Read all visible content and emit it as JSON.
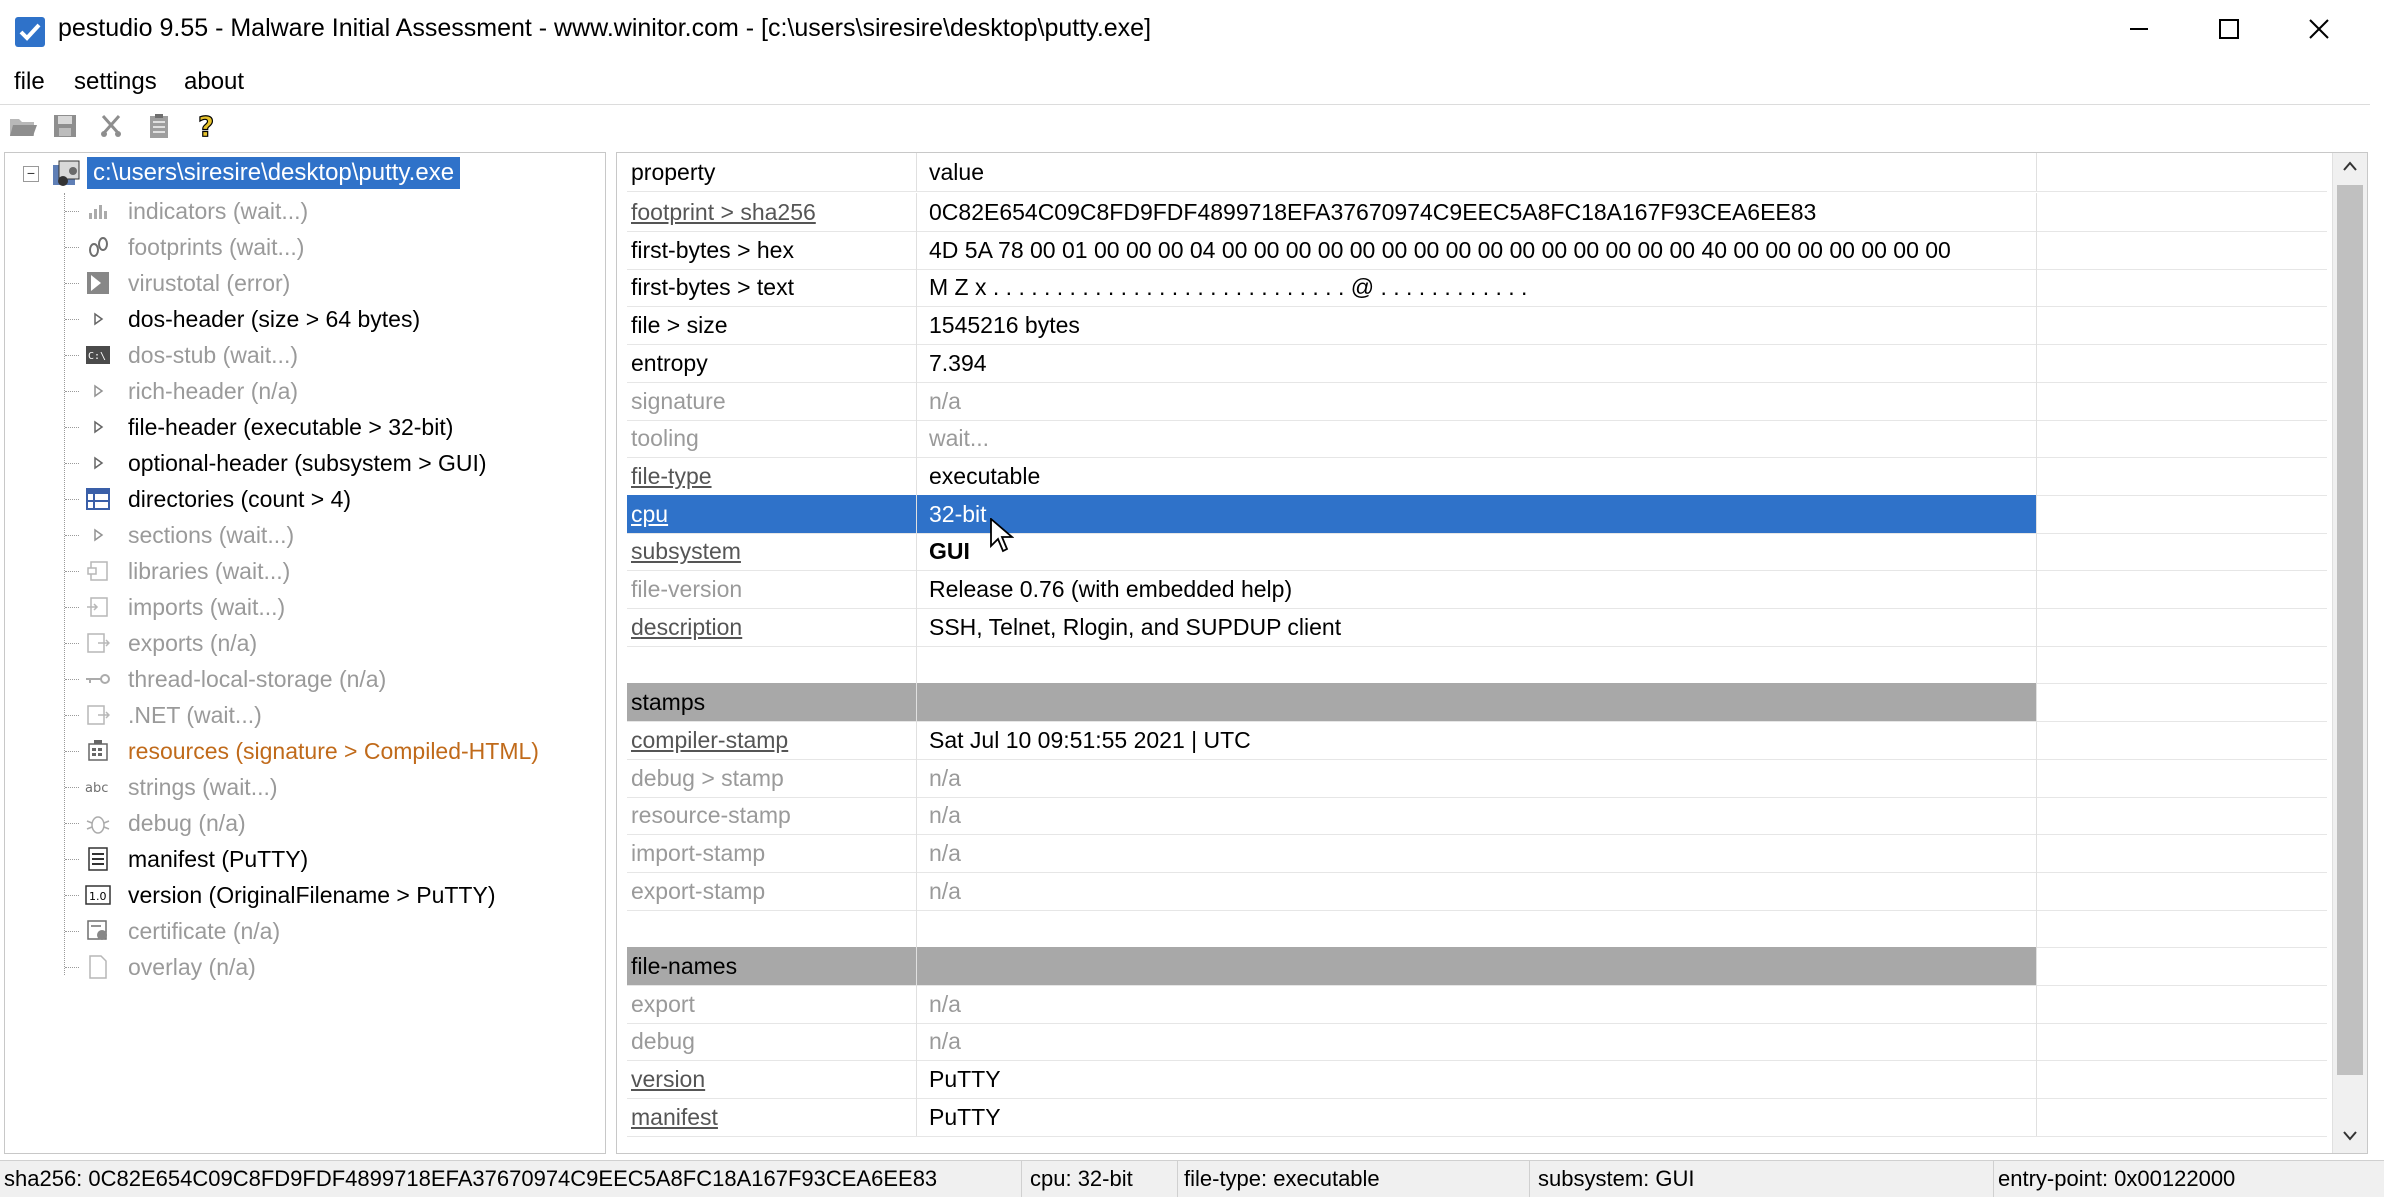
{
  "window": {
    "title": "pestudio 9.55 - Malware Initial Assessment - www.winitor.com - [c:\\users\\siresire\\desktop\\putty.exe]",
    "controls": {
      "minimize": "minimize-icon",
      "maximize": "maximize-icon",
      "close": "close-icon"
    }
  },
  "menubar": {
    "items": [
      "file",
      "settings",
      "about"
    ]
  },
  "toolbar": {
    "buttons": [
      "open-folder-icon",
      "save-icon",
      "cut-icon",
      "clipboard-icon",
      "help-icon"
    ]
  },
  "tree": {
    "root": {
      "label": "c:\\users\\siresire\\desktop\\putty.exe",
      "icon": "executable-icon",
      "expander": "−"
    },
    "items": [
      {
        "label": "indicators (wait...)",
        "icon": "bar-chart-icon",
        "state": "disabled"
      },
      {
        "label": "footprints (wait...)",
        "icon": "footprint-icon",
        "state": "disabled"
      },
      {
        "label": "virustotal (error)",
        "icon": "virustotal-icon",
        "state": "disabled"
      },
      {
        "label": "dos-header (size > 64 bytes)",
        "icon": "triangle-icon",
        "state": "active"
      },
      {
        "label": "dos-stub (wait...)",
        "icon": "console-icon",
        "state": "disabled"
      },
      {
        "label": "rich-header (n/a)",
        "icon": "triangle-icon",
        "state": "disabled"
      },
      {
        "label": "file-header (executable > 32-bit)",
        "icon": "triangle-icon",
        "state": "active"
      },
      {
        "label": "optional-header (subsystem > GUI)",
        "icon": "triangle-icon",
        "state": "active"
      },
      {
        "label": "directories (count > 4)",
        "icon": "grid-icon",
        "state": "active"
      },
      {
        "label": "sections (wait...)",
        "icon": "triangle-icon",
        "state": "disabled"
      },
      {
        "label": "libraries (wait...)",
        "icon": "library-icon",
        "state": "disabled"
      },
      {
        "label": "imports (wait...)",
        "icon": "import-icon",
        "state": "disabled"
      },
      {
        "label": "exports (n/a)",
        "icon": "export-icon",
        "state": "disabled"
      },
      {
        "label": "thread-local-storage (n/a)",
        "icon": "key-icon",
        "state": "disabled"
      },
      {
        "label": ".NET (wait...)",
        "icon": "dotnet-icon",
        "state": "disabled"
      },
      {
        "label": "resources (signature > Compiled-HTML)",
        "icon": "resources-icon",
        "state": "warn"
      },
      {
        "label": "strings (wait...)",
        "icon": "abc-icon",
        "state": "disabled"
      },
      {
        "label": "debug (n/a)",
        "icon": "bug-icon",
        "state": "disabled"
      },
      {
        "label": "manifest (PuTTY)",
        "icon": "manifest-icon",
        "state": "active"
      },
      {
        "label": "version (OriginalFilename > PuTTY)",
        "icon": "version-icon",
        "state": "active"
      },
      {
        "label": "certificate (n/a)",
        "icon": "certificate-icon",
        "state": "disabled"
      },
      {
        "label": "overlay (n/a)",
        "icon": "page-icon",
        "state": "disabled"
      }
    ]
  },
  "table": {
    "columns": [
      "property",
      "value"
    ],
    "rows": [
      {
        "type": "data",
        "property": "footprint > sha256",
        "value": "0C82E654C09C8FD9FDF4899718EFA37670974C9EEC5A8FC18A167F93CEA6EE83",
        "pstyle": "link",
        "vstyle": "normal"
      },
      {
        "type": "data",
        "property": "first-bytes > hex",
        "value": "4D 5A 78 00 01 00 00 00 04 00 00 00 00 00 00 00 00 00 00 00 00 00 00 00 40 00 00 00 00 00 00 00",
        "pstyle": "active",
        "vstyle": "normal"
      },
      {
        "type": "data",
        "property": "first-bytes > text",
        "value": "M Z x . . . . . . . . . . . . . . . . . . . . . . . . . . . . @ . . . . . . . . . . . .",
        "pstyle": "active",
        "vstyle": "normal"
      },
      {
        "type": "data",
        "property": "file > size",
        "value": "1545216 bytes",
        "pstyle": "active",
        "vstyle": "normal"
      },
      {
        "type": "data",
        "property": "entropy",
        "value": "7.394",
        "pstyle": "active",
        "vstyle": "normal"
      },
      {
        "type": "data",
        "property": "signature",
        "value": "n/a",
        "pstyle": "disabled",
        "vstyle": "muted"
      },
      {
        "type": "data",
        "property": "tooling",
        "value": "wait...",
        "pstyle": "disabled",
        "vstyle": "muted"
      },
      {
        "type": "data",
        "property": "file-type",
        "value": "executable",
        "pstyle": "link",
        "vstyle": "normal"
      },
      {
        "type": "selected",
        "property": "cpu",
        "value": "32-bit",
        "pstyle": "link",
        "vstyle": "normal"
      },
      {
        "type": "data",
        "property": "subsystem",
        "value": "GUI",
        "pstyle": "link",
        "vstyle": "bold"
      },
      {
        "type": "data",
        "property": "file-version",
        "value": "Release 0.76 (with embedded help)",
        "pstyle": "disabled",
        "vstyle": "normal"
      },
      {
        "type": "data",
        "property": "description",
        "value": "SSH, Telnet, Rlogin, and SUPDUP client",
        "pstyle": "link",
        "vstyle": "normal"
      },
      {
        "type": "blank",
        "property": "",
        "value": ""
      },
      {
        "type": "section",
        "property": "stamps",
        "value": ""
      },
      {
        "type": "data",
        "property": "compiler-stamp",
        "value": "Sat Jul 10 09:51:55 2021 | UTC",
        "pstyle": "link",
        "vstyle": "normal"
      },
      {
        "type": "data",
        "property": "debug > stamp",
        "value": "n/a",
        "pstyle": "disabled",
        "vstyle": "muted"
      },
      {
        "type": "data",
        "property": "resource-stamp",
        "value": "n/a",
        "pstyle": "disabled",
        "vstyle": "muted"
      },
      {
        "type": "data",
        "property": "import-stamp",
        "value": "n/a",
        "pstyle": "disabled",
        "vstyle": "muted"
      },
      {
        "type": "data",
        "property": "export-stamp",
        "value": "n/a",
        "pstyle": "disabled",
        "vstyle": "muted"
      },
      {
        "type": "blank",
        "property": "",
        "value": ""
      },
      {
        "type": "section",
        "property": "file-names",
        "value": ""
      },
      {
        "type": "data",
        "property": "export",
        "value": "n/a",
        "pstyle": "disabled",
        "vstyle": "muted"
      },
      {
        "type": "data",
        "property": "debug",
        "value": "n/a",
        "pstyle": "disabled",
        "vstyle": "muted"
      },
      {
        "type": "data",
        "property": "version",
        "value": "PuTTY",
        "pstyle": "link",
        "vstyle": "normal"
      },
      {
        "type": "data",
        "property": "manifest",
        "value": "PuTTY",
        "pstyle": "link",
        "vstyle": "normal"
      }
    ]
  },
  "statusbar": {
    "sha256": "sha256: 0C82E654C09C8FD9FDF4899718EFA37670974C9EEC5A8FC18A167F93CEA6EE83",
    "cpu": "cpu: 32-bit",
    "filetype": "file-type: executable",
    "subsystem": "subsystem: GUI",
    "entrypoint": "entry-point: 0x00122000"
  },
  "colors": {
    "selection": "#2f72c9",
    "section_header": "#a8a8a8",
    "disabled_text": "#9a9a9a",
    "warning_text": "#c06a1a"
  }
}
